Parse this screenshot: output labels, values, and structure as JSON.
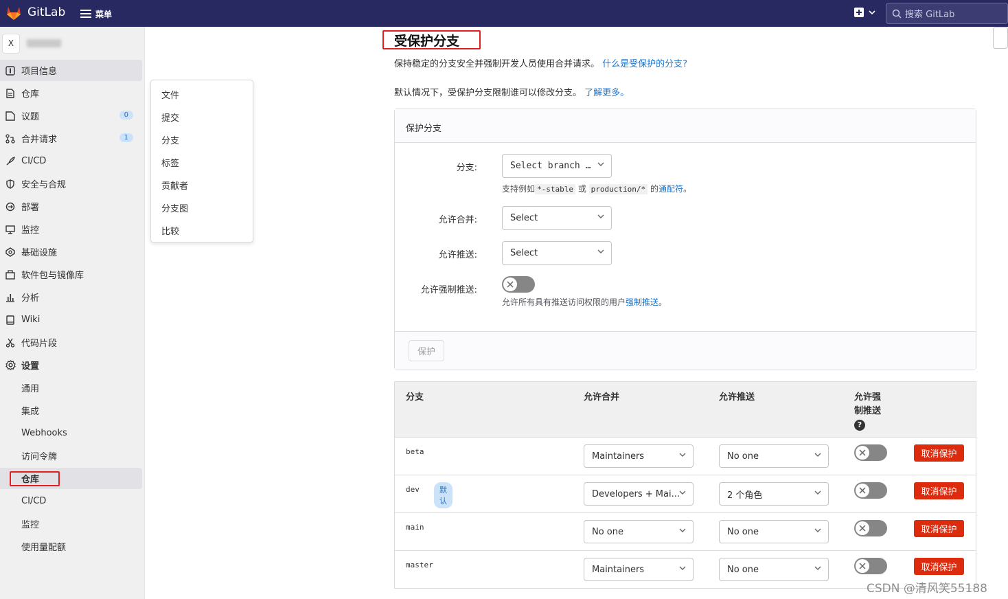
{
  "app": {
    "name": "GitLab",
    "menu_label": "菜单",
    "search_placeholder": "搜索 GitLab"
  },
  "project": {
    "avatar_letter": "X"
  },
  "sidebar": {
    "items": [
      {
        "label": "项目信息",
        "icon": "info-icon"
      },
      {
        "label": "仓库",
        "icon": "doc-icon"
      },
      {
        "label": "议题",
        "icon": "issues-icon",
        "badge": "0"
      },
      {
        "label": "合并请求",
        "icon": "merge-request-icon",
        "badge": "1"
      },
      {
        "label": "CI/CD",
        "icon": "rocket-icon"
      },
      {
        "label": "安全与合规",
        "icon": "shield-icon"
      },
      {
        "label": "部署",
        "icon": "deploy-icon"
      },
      {
        "label": "监控",
        "icon": "monitor-icon"
      },
      {
        "label": "基础设施",
        "icon": "cloud-icon"
      },
      {
        "label": "软件包与镜像库",
        "icon": "package-icon"
      },
      {
        "label": "分析",
        "icon": "chart-icon"
      },
      {
        "label": "Wiki",
        "icon": "book-icon"
      },
      {
        "label": "代码片段",
        "icon": "scissors-icon"
      },
      {
        "label": "设置",
        "icon": "gear-icon"
      }
    ],
    "settings_sub": [
      "通用",
      "集成",
      "Webhooks",
      "访问令牌",
      "仓库",
      "CI/CD",
      "监控",
      "使用量配额"
    ]
  },
  "flyout": {
    "items": [
      "文件",
      "提交",
      "分支",
      "标签",
      "贡献者",
      "分支图",
      "比较"
    ]
  },
  "page": {
    "title": "受保护分支",
    "desc1": "保持稳定的分支安全并强制开发人员使用合并请求。",
    "desc1_link": "什么是受保护的分支?",
    "desc2": "默认情况下，受保护分支限制谁可以修改分支。",
    "desc2_link": "了解更多。"
  },
  "form": {
    "card_title": "保护分支",
    "branch_label": "分支:",
    "branch_value": "Select branch …",
    "hint_prefix": "支持例如",
    "hint_code1": "*-stable",
    "hint_or": "或",
    "hint_code2": "production/*",
    "hint_mid": "的",
    "hint_link": "通配符",
    "hint_end": "。",
    "merge_label": "允许合并:",
    "merge_value": "Select",
    "push_label": "允许推送:",
    "push_value": "Select",
    "force_label": "允许强制推送:",
    "force_hint": "允许所有具有推送访问权限的用户",
    "force_hint_link": "强制推送",
    "force_hint_end": "。",
    "protect_button": "保护"
  },
  "table": {
    "headers": {
      "branch": "分支",
      "merge": "允许合并",
      "push": "允许推送",
      "force_line1": "允许强",
      "force_line2": "制推送"
    },
    "rows": [
      {
        "branch": "beta",
        "merge": "Maintainers",
        "push": "No one",
        "action": "取消保护"
      },
      {
        "branch": "dev",
        "badge": "默认",
        "merge": "Developers + Mai...",
        "push": "2 个角色",
        "action": "取消保护"
      },
      {
        "branch": "main",
        "merge": "No one",
        "push": "No one",
        "action": "取消保护"
      },
      {
        "branch": "master",
        "merge": "Maintainers",
        "push": "No one",
        "action": "取消保护"
      }
    ]
  },
  "watermark": "CSDN @清风笑55188"
}
